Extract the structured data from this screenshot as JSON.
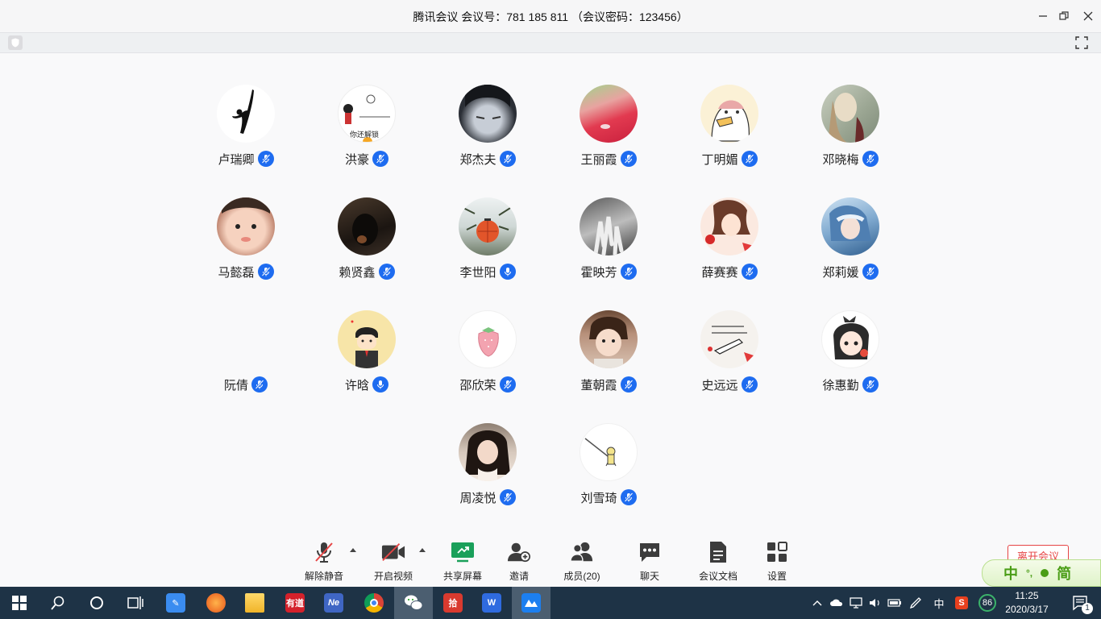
{
  "window": {
    "title": "腾讯会议 会议号：781 185 811 （会议密码：123456）"
  },
  "participants": [
    {
      "name": "卢瑞卿",
      "avatar": "silhouette-dancer",
      "mic": "muted"
    },
    {
      "name": "洪豪",
      "avatar": "cartoon-unlock",
      "mic": "muted"
    },
    {
      "name": "郑杰夫",
      "avatar": "anime-boy",
      "mic": "muted"
    },
    {
      "name": "王丽霞",
      "avatar": "red-green-abstract",
      "mic": "muted"
    },
    {
      "name": "丁明媚",
      "avatar": "cartoon-duck",
      "mic": "muted"
    },
    {
      "name": "邓晓梅",
      "avatar": "painted-girl",
      "mic": "muted"
    },
    {
      "name": "马懿磊",
      "avatar": "baby-face",
      "mic": "muted"
    },
    {
      "name": "赖贤鑫",
      "avatar": "dark-dog",
      "mic": "muted"
    },
    {
      "name": "李世阳",
      "avatar": "red-lantern",
      "mic": "on"
    },
    {
      "name": "霍映芳",
      "avatar": "hands-bw",
      "mic": "muted"
    },
    {
      "name": "薛赛赛",
      "avatar": "anime-girl-red",
      "mic": "muted"
    },
    {
      "name": "郑莉媛",
      "avatar": "anime-girl-blue",
      "mic": "muted"
    },
    {
      "name": "阮倩",
      "avatar": "none",
      "mic": "muted"
    },
    {
      "name": "许晗",
      "avatar": "cartoon-boy",
      "mic": "on"
    },
    {
      "name": "邵欣荣",
      "avatar": "strawberry",
      "mic": "muted"
    },
    {
      "name": "董朝霞",
      "avatar": "toddler",
      "mic": "muted"
    },
    {
      "name": "史远远",
      "avatar": "handwritten-sticker",
      "mic": "muted"
    },
    {
      "name": "徐惠勤",
      "avatar": "cartoon-girl-bow",
      "mic": "muted"
    },
    {
      "name": "周凌悦",
      "avatar": "girl-photo",
      "mic": "muted"
    },
    {
      "name": "刘雪琦",
      "avatar": "tiny-figure",
      "mic": "muted"
    }
  ],
  "avatar_texts": {
    "unlock": "你还解锁"
  },
  "toolbar": {
    "unmute_label": "解除静音",
    "video_label": "开启视频",
    "share_label": "共享屏幕",
    "invite_label": "邀请",
    "members_label": "成员(20)",
    "chat_label": "聊天",
    "docs_label": "会议文档",
    "settings_label": "设置",
    "leave_label": "离开会议"
  },
  "ime": {
    "lang": "中",
    "mode": "简"
  },
  "taskbar": {
    "apps": [
      "app-feishu",
      "app-firefox",
      "app-explorer",
      "app-youdao",
      "app-netease",
      "app-chrome",
      "app-wechat",
      "app-pinduoduo",
      "app-wps",
      "app-tencent-meeting"
    ],
    "youdao_text": "有道",
    "netease_text": "Ne",
    "pdd_text": "拾",
    "ime_lang": "中",
    "battery_score": "86",
    "time": "11:25",
    "date": "2020/3/17",
    "notifications": "1"
  },
  "colors": {
    "mic_blue": "#1e6cf0",
    "muted_red": "#e64545",
    "taskbar": "#1e3346",
    "share_green": "#1aa05a"
  }
}
